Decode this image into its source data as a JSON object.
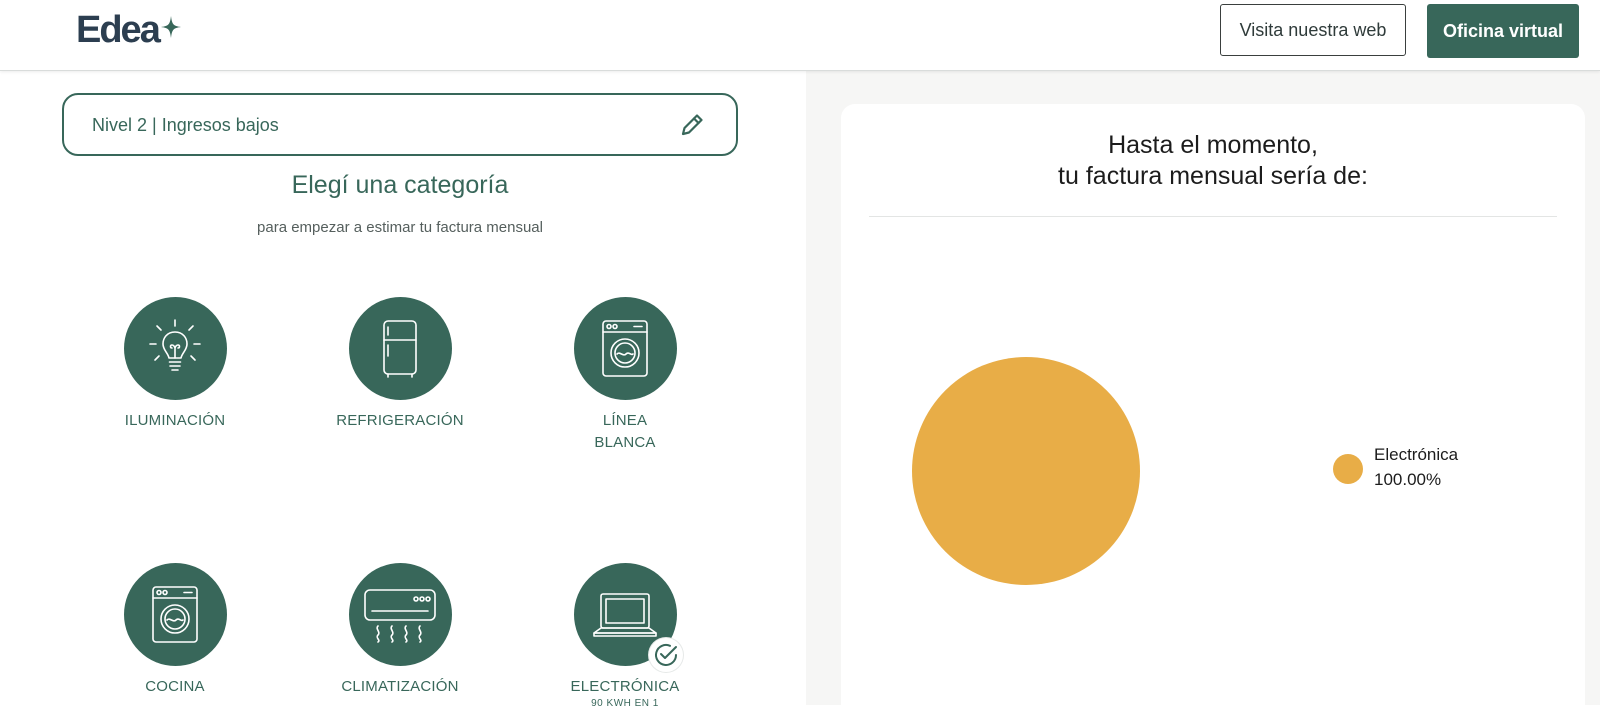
{
  "header": {
    "logo_text": "Edea",
    "visit_button": "Visita nuestra web",
    "office_button": "Oficina virtual"
  },
  "level": {
    "label": "Nivel 2 | Ingresos bajos"
  },
  "categories_section": {
    "title": "Elegí una categoría",
    "subtitle": "para empezar a estimar tu factura mensual",
    "items": [
      {
        "label": "ILUMINACIÓN",
        "icon": "lightbulb-icon",
        "selected": false
      },
      {
        "label": "REFRIGERACIÓN",
        "icon": "fridge-icon",
        "selected": false
      },
      {
        "label": "LÍNEA",
        "label2": "BLANCA",
        "icon": "washing-machine-icon",
        "selected": false
      },
      {
        "label": "COCINA",
        "icon": "oven-icon",
        "selected": false
      },
      {
        "label": "CLIMATIZACIÓN",
        "icon": "air-conditioner-icon",
        "selected": false
      },
      {
        "label": "ELECTRÓNICA",
        "sub": "90 KWH EN 1",
        "icon": "laptop-icon",
        "selected": true
      }
    ]
  },
  "summary": {
    "title_line1": "Hasta el momento,",
    "title_line2": "tu factura mensual sería de:"
  },
  "chart_data": {
    "type": "pie",
    "slices": [
      {
        "label": "Electrónica",
        "value": 100.0,
        "percent_label": "100.00%",
        "color": "#e8ad47"
      }
    ],
    "legend_position": "right"
  },
  "colors": {
    "brand_green": "#38675a",
    "pie_yellow": "#e8ad47"
  }
}
